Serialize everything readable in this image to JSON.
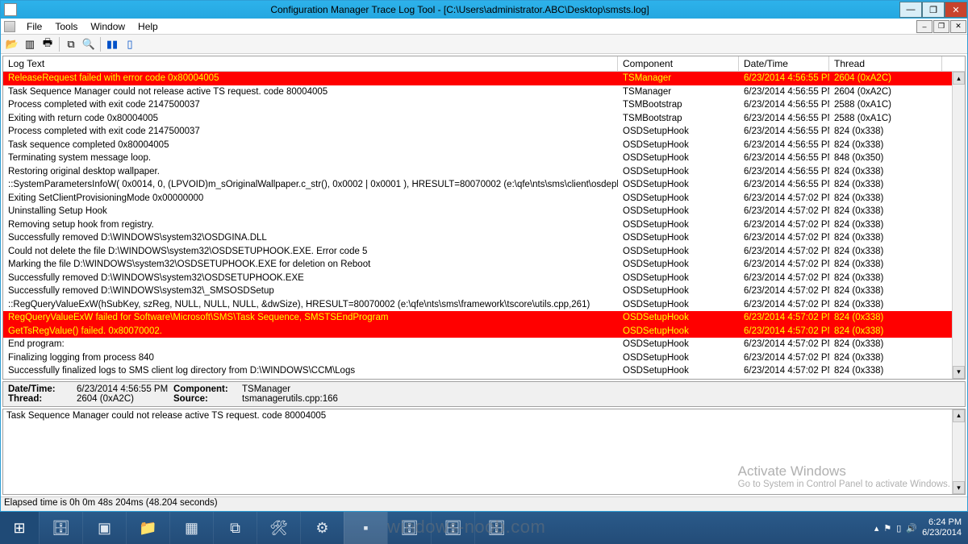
{
  "title": "Configuration Manager Trace Log Tool - [C:\\Users\\administrator.ABC\\Desktop\\smsts.log]",
  "menu": {
    "file": "File",
    "tools": "Tools",
    "window": "Window",
    "help": "Help"
  },
  "columns": {
    "log": "Log Text",
    "component": "Component",
    "date": "Date/Time",
    "thread": "Thread"
  },
  "rows": [
    {
      "log": "ReleaseRequest failed with error code 0x80004005",
      "comp": "TSManager",
      "date": "6/23/2014 4:56:55 PM",
      "thread": "2604 (0xA2C)",
      "err": true
    },
    {
      "log": "Task Sequence Manager could not release active TS request. code 80004005",
      "comp": "TSManager",
      "date": "6/23/2014 4:56:55 PM",
      "thread": "2604 (0xA2C)"
    },
    {
      "log": "Process completed with exit code 2147500037",
      "comp": "TSMBootstrap",
      "date": "6/23/2014 4:56:55 PM",
      "thread": "2588 (0xA1C)"
    },
    {
      "log": "Exiting with return code 0x80004005",
      "comp": "TSMBootstrap",
      "date": "6/23/2014 4:56:55 PM",
      "thread": "2588 (0xA1C)"
    },
    {
      "log": "Process completed with exit code 2147500037",
      "comp": "OSDSetupHook",
      "date": "6/23/2014 4:56:55 PM",
      "thread": "824 (0x338)"
    },
    {
      "log": "Task sequence completed 0x80004005",
      "comp": "OSDSetupHook",
      "date": "6/23/2014 4:56:55 PM",
      "thread": "824 (0x338)"
    },
    {
      "log": "Terminating system message loop.",
      "comp": "OSDSetupHook",
      "date": "6/23/2014 4:56:55 PM",
      "thread": "848 (0x350)"
    },
    {
      "log": "Restoring original desktop wallpaper.",
      "comp": "OSDSetupHook",
      "date": "6/23/2014 4:56:55 PM",
      "thread": "824 (0x338)"
    },
    {
      "log": "::SystemParametersInfoW( 0x0014, 0, (LPVOID)m_sOriginalWallpaper.c_str(), 0x0002 | 0x0001 ), HRESULT=80070002 (e:\\qfe\\nts\\sms\\client\\osdeployment\\osdgina\\...",
      "comp": "OSDSetupHook",
      "date": "6/23/2014 4:56:55 PM",
      "thread": "824 (0x338)"
    },
    {
      "log": "Exiting SetClientProvisioningMode 0x00000000",
      "comp": "OSDSetupHook",
      "date": "6/23/2014 4:57:02 PM",
      "thread": "824 (0x338)"
    },
    {
      "log": "Uninstalling Setup Hook",
      "comp": "OSDSetupHook",
      "date": "6/23/2014 4:57:02 PM",
      "thread": "824 (0x338)"
    },
    {
      "log": "Removing setup hook from registry.",
      "comp": "OSDSetupHook",
      "date": "6/23/2014 4:57:02 PM",
      "thread": "824 (0x338)"
    },
    {
      "log": "Successfully removed D:\\WINDOWS\\system32\\OSDGINA.DLL",
      "comp": "OSDSetupHook",
      "date": "6/23/2014 4:57:02 PM",
      "thread": "824 (0x338)"
    },
    {
      "log": "Could not delete the file D:\\WINDOWS\\system32\\OSDSETUPHOOK.EXE. Error code 5",
      "comp": "OSDSetupHook",
      "date": "6/23/2014 4:57:02 PM",
      "thread": "824 (0x338)"
    },
    {
      "log": "Marking the file D:\\WINDOWS\\system32\\OSDSETUPHOOK.EXE for deletion on Reboot",
      "comp": "OSDSetupHook",
      "date": "6/23/2014 4:57:02 PM",
      "thread": "824 (0x338)"
    },
    {
      "log": "Successfully removed D:\\WINDOWS\\system32\\OSDSETUPHOOK.EXE",
      "comp": "OSDSetupHook",
      "date": "6/23/2014 4:57:02 PM",
      "thread": "824 (0x338)"
    },
    {
      "log": "Successfully removed D:\\WINDOWS\\system32\\_SMSOSDSetup",
      "comp": "OSDSetupHook",
      "date": "6/23/2014 4:57:02 PM",
      "thread": "824 (0x338)"
    },
    {
      "log": "::RegQueryValueExW(hSubKey, szReg, NULL, NULL, NULL, &dwSize), HRESULT=80070002 (e:\\qfe\\nts\\sms\\framework\\tscore\\utils.cpp,261)",
      "comp": "OSDSetupHook",
      "date": "6/23/2014 4:57:02 PM",
      "thread": "824 (0x338)"
    },
    {
      "log": "RegQueryValueExW failed for Software\\Microsoft\\SMS\\Task Sequence, SMSTSEndProgram",
      "comp": "OSDSetupHook",
      "date": "6/23/2014 4:57:02 PM",
      "thread": "824 (0x338)",
      "err": true
    },
    {
      "log": "GetTsRegValue() failed. 0x80070002.",
      "comp": "OSDSetupHook",
      "date": "6/23/2014 4:57:02 PM",
      "thread": "824 (0x338)",
      "err": true
    },
    {
      "log": "End program: ",
      "comp": "OSDSetupHook",
      "date": "6/23/2014 4:57:02 PM",
      "thread": "824 (0x338)"
    },
    {
      "log": "Finalizing logging from process 840",
      "comp": "OSDSetupHook",
      "date": "6/23/2014 4:57:02 PM",
      "thread": "824 (0x338)"
    },
    {
      "log": "Successfully finalized logs to SMS client log directory from D:\\WINDOWS\\CCM\\Logs",
      "comp": "OSDSetupHook",
      "date": "6/23/2014 4:57:02 PM",
      "thread": "824 (0x338)"
    }
  ],
  "detail": {
    "datetime_label": "Date/Time:",
    "datetime": "6/23/2014 4:56:55 PM",
    "component_label": "Component:",
    "component": "TSManager",
    "thread_label": "Thread:",
    "thread": "2604 (0xA2C)",
    "source_label": "Source:",
    "source": "tsmanagerutils.cpp:166"
  },
  "message": "Task Sequence Manager could not release active TS request. code 80004005",
  "watermark": {
    "l1": "Activate Windows",
    "l2": "Go to System in Control Panel to activate Windows."
  },
  "status": "Elapsed time is 0h 0m 48s 204ms (48.204 seconds)",
  "tray": {
    "time": "6:24 PM",
    "date": "6/23/2014"
  },
  "noob": "windows-noob.com"
}
